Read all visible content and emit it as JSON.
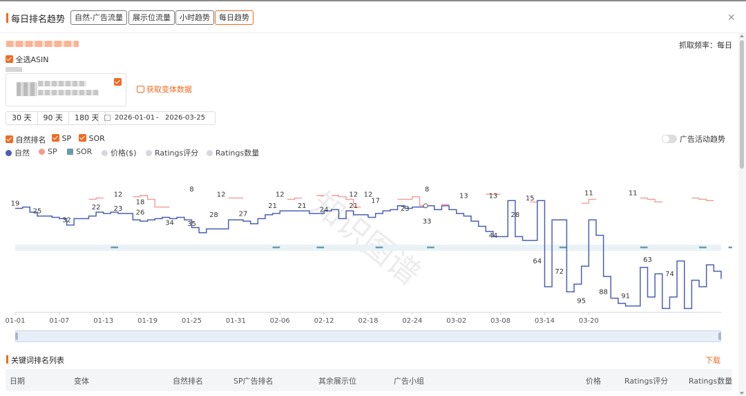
{
  "header": {
    "title": "每日排名趋势",
    "tabs": [
      "自然-广告流量",
      "展示位流量",
      "小时趋势",
      "每日趋势"
    ],
    "active_tab": 3
  },
  "frequency": "抓取频率：每日",
  "select_all": "全选ASIN",
  "fetch_variants": "获取变体数据",
  "ranges": [
    "30 天",
    "90 天",
    "180 天"
  ],
  "date_start": "2026-01-01",
  "date_sep": "-",
  "date_end": "2026-03-25",
  "series_checks": [
    "自然排名",
    "SP",
    "SOR"
  ],
  "ad_trend_toggle": "广告活动趋势",
  "legend": [
    {
      "label": "自然",
      "color": "#4a5fb4",
      "shape": "circle"
    },
    {
      "label": "SP",
      "color": "#f29b95",
      "shape": "circle"
    },
    {
      "label": "SOR",
      "color": "#6a9bab",
      "shape": "square"
    },
    {
      "label": "价格($)",
      "color": "#d7d8de",
      "shape": "circle"
    },
    {
      "label": "Ratings评分",
      "color": "#d7d8de",
      "shape": "circle"
    },
    {
      "label": "Ratings数量",
      "color": "#d7d8de",
      "shape": "circle"
    }
  ],
  "chart_data": {
    "type": "line",
    "x_tick_labels": [
      "01-01",
      "01-07",
      "01-13",
      "01-19",
      "01-25",
      "01-31",
      "02-06",
      "02-12",
      "02-18",
      "02-24",
      "03-02",
      "03-08",
      "03-14",
      "03-20"
    ],
    "series": [
      {
        "name": "自然",
        "color": "#4a5fb4",
        "values": [
          19,
          18,
          22,
          25,
          25,
          26,
          27,
          32,
          27,
          27,
          25,
          22,
          23,
          22,
          23,
          23,
          28,
          29,
          28,
          27,
          26,
          27,
          26,
          28,
          34,
          38,
          35,
          35,
          35,
          28,
          28,
          29,
          31,
          27,
          24,
          23,
          21,
          21,
          21,
          21,
          23,
          23,
          21,
          20,
          27,
          21,
          24,
          24,
          26,
          23,
          21,
          20,
          17,
          19,
          18,
          18,
          17,
          20,
          17,
          20,
          23,
          25,
          29,
          33,
          37,
          41,
          41,
          13,
          41,
          44,
          44,
          13,
          80,
          28,
          28,
          84,
          78,
          64,
          28,
          40,
          72,
          89,
          93,
          95,
          95,
          65,
          88,
          70,
          97,
          88,
          60,
          97,
          75,
          80,
          63,
          68,
          74
        ]
      },
      {
        "name": "SP",
        "color": "#f29b95",
        "values": [
          null,
          null,
          null,
          null,
          null,
          null,
          null,
          null,
          null,
          null,
          12,
          11,
          null,
          null,
          null,
          null,
          10,
          9,
          12,
          18,
          18,
          null,
          null,
          null,
          null,
          null,
          null,
          null,
          null,
          11,
          11,
          null,
          null,
          null,
          null,
          null,
          null,
          12,
          11,
          null,
          null,
          9,
          null,
          9,
          10,
          12,
          18,
          null,
          null,
          null,
          null,
          null,
          12,
          12,
          10,
          17,
          null,
          null,
          16,
          null,
          null,
          null,
          null,
          null,
          8,
          8,
          null,
          null,
          null,
          null,
          14,
          13,
          null,
          null,
          null,
          null,
          null,
          15,
          12,
          null,
          null,
          null,
          null,
          null,
          null,
          11,
          12,
          14,
          null,
          null,
          null,
          null,
          11,
          12,
          13,
          null,
          null
        ]
      },
      {
        "name": "SOR",
        "color": "#6a9bab",
        "segments": [
          [
            13,
            14
          ],
          [
            25,
            25
          ],
          [
            35,
            36
          ],
          [
            41,
            42
          ],
          [
            49,
            50
          ],
          [
            56,
            57
          ],
          [
            74,
            75
          ],
          [
            85,
            86
          ],
          [
            93,
            94
          ],
          [
            97,
            99
          ]
        ]
      }
    ],
    "point_labels": [
      {
        "series": "自然",
        "day": 0,
        "value": 19
      },
      {
        "series": "自然",
        "day": 3,
        "value": 25
      },
      {
        "series": "自然",
        "day": 7,
        "value": 32
      },
      {
        "series": "自然",
        "day": 11,
        "value": 22
      },
      {
        "series": "自然",
        "day": 14,
        "value": 23
      },
      {
        "series": "自然",
        "day": 17,
        "value": 26
      },
      {
        "series": "自然",
        "day": 21,
        "value": 34
      },
      {
        "series": "自然",
        "day": 24,
        "value": 35
      },
      {
        "series": "自然",
        "day": 27,
        "value": 28
      },
      {
        "series": "自然",
        "day": 31,
        "value": 27
      },
      {
        "series": "自然",
        "day": 35,
        "value": 21
      },
      {
        "series": "自然",
        "day": 39,
        "value": 21
      },
      {
        "series": "自然",
        "day": 42,
        "value": 24
      },
      {
        "series": "自然",
        "day": 46,
        "value": 21
      },
      {
        "series": "自然",
        "day": 53,
        "value": 23
      },
      {
        "series": "自然",
        "day": 56,
        "value": 33
      },
      {
        "series": "自然",
        "day": 61,
        "value": 13
      },
      {
        "series": "自然",
        "day": 65,
        "value": 44
      },
      {
        "series": "自然",
        "day": 68,
        "value": 28
      },
      {
        "series": "自然",
        "day": 71,
        "value": 64
      },
      {
        "series": "自然",
        "day": 74,
        "value": 72
      },
      {
        "series": "自然",
        "day": 77,
        "value": 95
      },
      {
        "series": "自然",
        "day": 80,
        "value": 88
      },
      {
        "series": "自然",
        "day": 83,
        "value": 91
      },
      {
        "series": "自然",
        "day": 86,
        "value": 63
      },
      {
        "series": "自然",
        "day": 89,
        "value": 74
      },
      {
        "series": "SP",
        "day": 14,
        "value": 12
      },
      {
        "series": "SP",
        "day": 17,
        "value": 18
      },
      {
        "series": "SP",
        "day": 24,
        "value": 8
      },
      {
        "series": "SP",
        "day": 28,
        "value": 12
      },
      {
        "series": "SP",
        "day": 36,
        "value": 12
      },
      {
        "series": "SP",
        "day": 46,
        "value": 12
      },
      {
        "series": "SP",
        "day": 48,
        "value": 12
      },
      {
        "series": "SP",
        "day": 49,
        "value": 17
      },
      {
        "series": "SP",
        "day": 56,
        "value": 8
      },
      {
        "series": "SP",
        "day": 65,
        "value": 13
      },
      {
        "series": "SP",
        "day": 70,
        "value": 15
      },
      {
        "series": "SP",
        "day": 78,
        "value": 11
      },
      {
        "series": "SP",
        "day": 84,
        "value": 11
      }
    ],
    "yrange": [
      1,
      100
    ],
    "y_inverted": true
  },
  "keyword_section": {
    "title": "关键词排名列表",
    "download": "下载",
    "columns": [
      "日期",
      "变体",
      "自然排名",
      "SP广告排名",
      "其余展示位",
      "广告小组",
      "价格",
      "Ratings评分",
      "Ratings数量"
    ]
  },
  "watermark": "知识图谱"
}
